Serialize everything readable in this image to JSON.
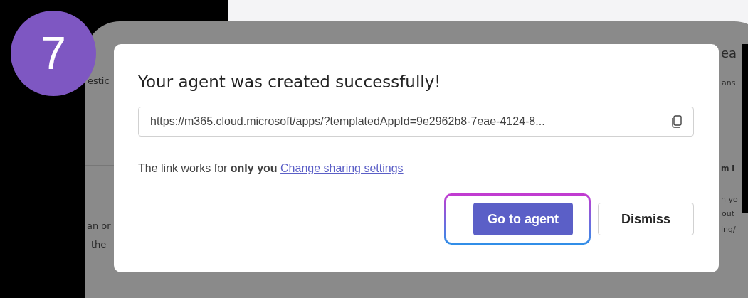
{
  "step_badge": "7",
  "background": {
    "left_fragments": [
      "estic",
      "an or",
      "the"
    ],
    "right_fragments": [
      "ea",
      "ans",
      "m i",
      "n yo",
      "out",
      "ing/"
    ]
  },
  "dialog": {
    "title": "Your agent was created successfully!",
    "link_field": {
      "value": "https://m365.cloud.microsoft/apps/?templatedAppId=9e2962b8-7eae-4124-8..."
    },
    "sharing_note": "The link works for **only you**",
    "sharing_link": "Change sharing settings",
    "buttons": [
      {
        "label": "Go to agent",
        "kind": "primary",
        "highlighted": true
      },
      {
        "label": "Dismiss",
        "kind": "secondary",
        "highlighted": false
      }
    ]
  }
}
